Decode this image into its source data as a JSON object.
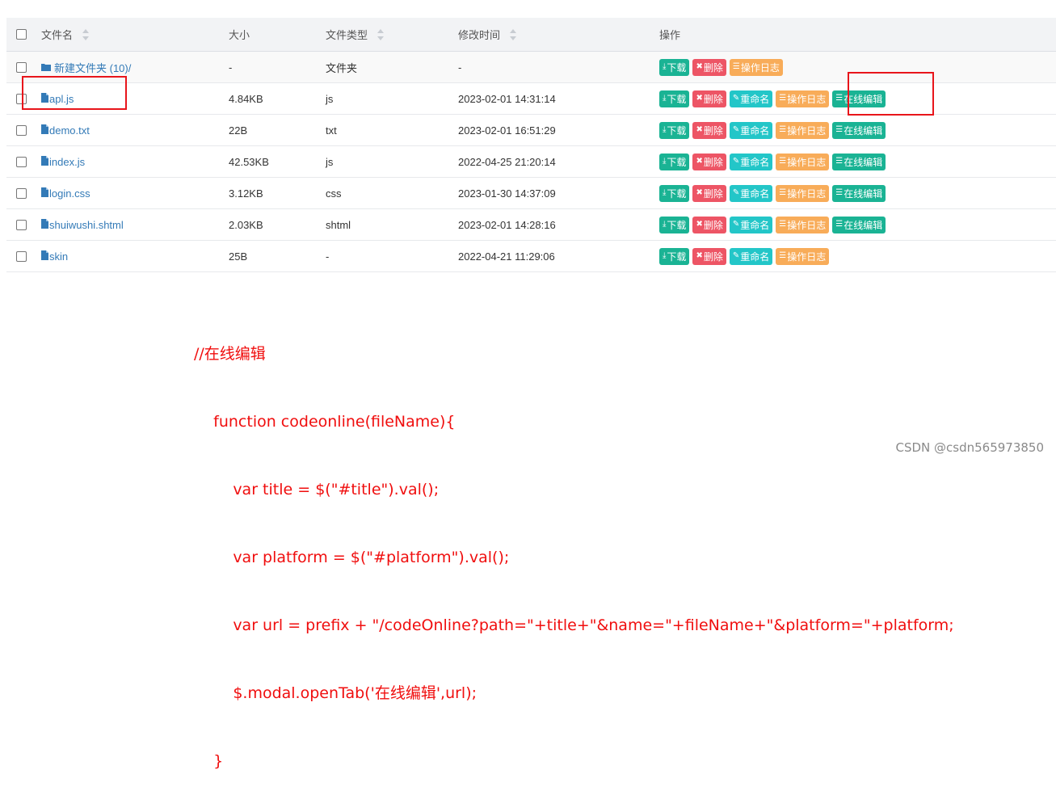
{
  "table": {
    "headers": {
      "name": "文件名",
      "size": "大小",
      "type": "文件类型",
      "modified": "修改时间",
      "ops": "操作"
    },
    "labels": {
      "download": "下载",
      "delete": "删除",
      "rename": "重命名",
      "log": "操作日志",
      "edit": "在线编辑"
    },
    "rows": [
      {
        "name": "新建文件夹 (10)/",
        "size": "-",
        "type": "文件夹",
        "time": "-",
        "kind": "folder"
      },
      {
        "name": "apl.js",
        "size": "4.84KB",
        "type": "js",
        "time": "2023-02-01 14:31:14",
        "kind": "file"
      },
      {
        "name": "demo.txt",
        "size": "22B",
        "type": "txt",
        "time": "2023-02-01 16:51:29",
        "kind": "file"
      },
      {
        "name": "index.js",
        "size": "42.53KB",
        "type": "js",
        "time": "2022-04-25 21:20:14",
        "kind": "file"
      },
      {
        "name": "login.css",
        "size": "3.12KB",
        "type": "css",
        "time": "2023-01-30 14:37:09",
        "kind": "file"
      },
      {
        "name": "shuiwushi.shtml",
        "size": "2.03KB",
        "type": "shtml",
        "time": "2023-02-01 14:28:16",
        "kind": "file"
      },
      {
        "name": "skin",
        "size": "25B",
        "type": "-",
        "time": "2022-04-21 11:29:06",
        "kind": "file"
      }
    ]
  },
  "annotation": {
    "lines": [
      "//在线编辑",
      "    function codeonline(fileName){",
      "        var title = $(\"#title\").val();",
      "        var platform = $(\"#platform\").val();",
      "        var url = prefix + \"/codeOnline?path=\"+title+\"&name=\"+fileName+\"&platform=\"+platform;",
      "        $.modal.openTab('在线编辑',url);",
      "    }"
    ]
  },
  "watermark": "CSDN @csdn565973850",
  "colors": {
    "download": "#1ab394",
    "delete": "#ed5565",
    "rename": "#23c6c8",
    "log": "#f8ac59",
    "edit": "#1ab394",
    "highlight": "#e8151b",
    "code": "#f00e0e"
  }
}
